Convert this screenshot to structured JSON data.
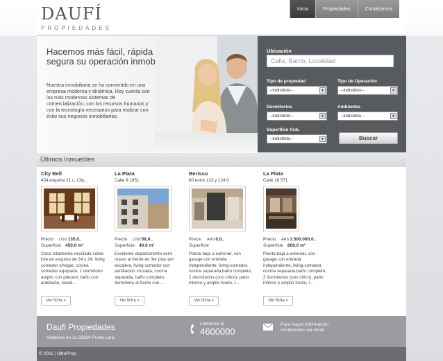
{
  "brand": {
    "name": "DAUFÍ",
    "tagline": "PROPIEDADES"
  },
  "nav": [
    {
      "label": "Inicio",
      "active": true
    },
    {
      "label": "Propiedades",
      "active": false
    },
    {
      "label": "Contáctenos",
      "active": false
    }
  ],
  "hero": {
    "title": "Hacemos más fácil, rápida y segura su operación inmobiliaria",
    "text": "Nuestra inmobiliaria se ha convertido en una empresa moderna y dinámica. Hoy cuenta con los más modernos sistemas de comercialización, con los recursos humanos y con la tecnología necesarios para realizar con éxito sus negocios inmobiliarios."
  },
  "search": {
    "location_label": "Ubicación",
    "location_placeholder": "Calle, Barrio, Localidad",
    "property_type_label": "Tipo de propiedad",
    "property_type_value": "--indistinto--",
    "operation_label": "Tipo de Operación",
    "operation_value": "--indistinto--",
    "bedrooms_label": "Dormitorios",
    "bedrooms_value": "--indistinto--",
    "rooms_label": "Ambientes",
    "rooms_value": "--indistinto--",
    "area_label": "Superficie Cub.",
    "area_value": "--indistinto--",
    "button_label": "Buscar"
  },
  "listings": {
    "heading": "Últimos Inmuebles",
    "price_label": "Precio",
    "area_label": "Superficie",
    "more_label": "Ver ficha »",
    "items": [
      {
        "city": "City Bell",
        "address": "454 esquina 21 c, City...",
        "currency": "USD",
        "price": "135,0..",
        "area": "450.0 m²",
        "description": "Casa totalmente reciclada sobre lote en esquina de 24 x 24, living comedor c/hogar, cocina comedor equipada, 1 dormitorio amplio con placard, baño con antebaño, lavad..."
      },
      {
        "city": "La Plata",
        "address": "Calle 9 1651",
        "currency": "USD",
        "price": "58,0..",
        "area": "40.0 m²",
        "description": "Excelente departamento semi nuevo al frente en 3er piso por escalera, living comedor con ventilacion cruzada, cocina separada, baño completo, dormitorio al frente con ..."
      },
      {
        "city": "Berisso",
        "address": "60 entre 123 y 124 0",
        "currency": "ARS",
        "price": "0,0..",
        "area": "",
        "description": "Planta baja a extrenar, con garage con entrada independiente, living-comedor, cocina separada,baño completo, 2 dormitorios (uno chico), patio interno y amplio fondo, l..."
      },
      {
        "city": "La Plata",
        "address": "Calle 18 571",
        "currency": "ARS",
        "price": "1.500.000,0..",
        "area": "600.0 m²",
        "description": "Planta baja a extrenar, con garage con entrada independiente, living-comedor, cocina separada,baño completo, 2 dormitorios (uno chico), patio interno y amplio fondo, l..."
      }
    ]
  },
  "footer": {
    "title": "Daufi Propiedades",
    "visit": "Visitenos en 11 28100 Punta Lara.",
    "phone_label": "Llámenos al",
    "phone": "4600000",
    "email_text": "Para mayor información contáctenos vía email",
    "copyright": "© 2011 | UltraProp"
  },
  "colors": {
    "search_panel": "#575a5f",
    "footer": "#9a9c9f",
    "nav_active": "#454545"
  }
}
